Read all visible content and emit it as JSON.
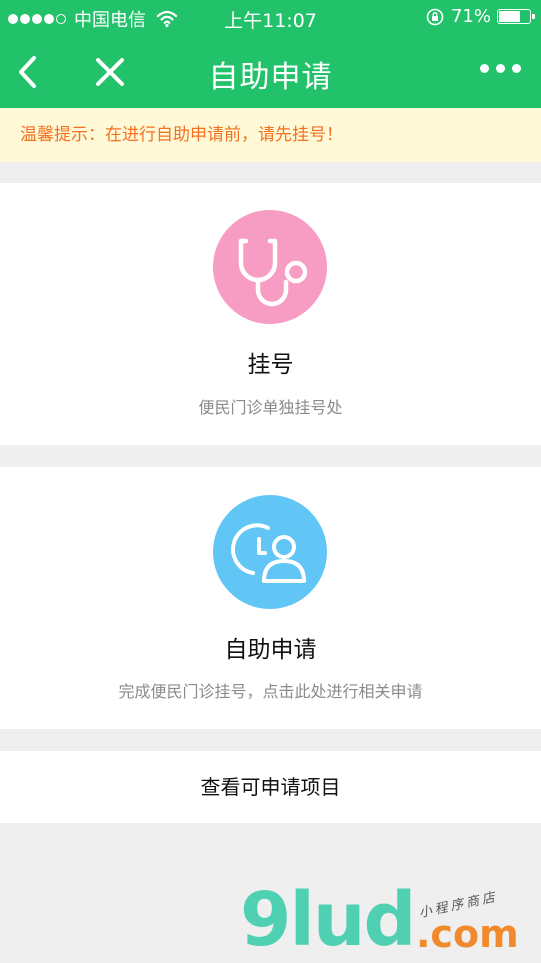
{
  "status_bar": {
    "carrier": "中国电信",
    "time": "上午11:07",
    "battery_percent": "71%",
    "battery_level": 0.71,
    "icons": [
      "signal-dots-icon",
      "wifi-icon",
      "rotation-lock-icon",
      "battery-icon"
    ]
  },
  "nav": {
    "title": "自助申请",
    "icons": [
      "back-arrow-icon",
      "close-icon",
      "more-icon"
    ]
  },
  "notice": {
    "text": "温馨提示：在进行自助申请前，请先挂号！"
  },
  "cards": [
    {
      "title": "挂号",
      "description": "便民门诊单独挂号处",
      "icon": "stethoscope-icon",
      "color": "#f79cc2"
    },
    {
      "title": "自助申请",
      "description": "完成便民门诊挂号，点击此处进行相关申请",
      "icon": "clock-user-icon",
      "color": "#61c6f5"
    }
  ],
  "link": {
    "label": "查看可申请项目"
  },
  "watermark": {
    "brand": "9lud",
    "domain": ".com",
    "tagline": "小程序商店"
  },
  "colors": {
    "header_green": "#22c26b",
    "notice_bg": "#fff9d7",
    "notice_text": "#f3711f"
  }
}
